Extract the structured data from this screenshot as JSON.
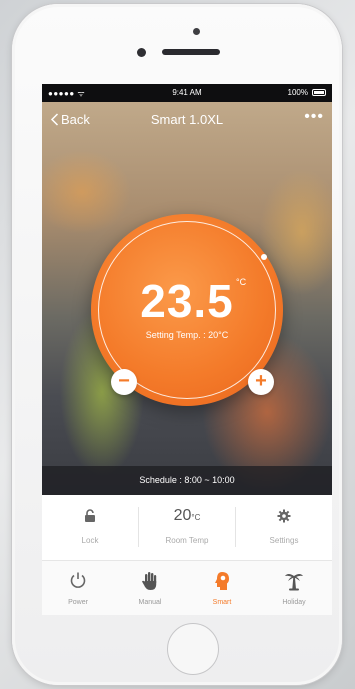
{
  "status_bar": {
    "signal": "●●●●● ᯤ",
    "time": "9:41 AM",
    "battery": "100%"
  },
  "nav": {
    "back_label": "Back",
    "title": "Smart 1.0XL",
    "more": "•••"
  },
  "dial": {
    "temperature": "23.5",
    "unit": "°C",
    "setting_text": "Setting Temp. : 20°C",
    "minus": "−",
    "plus": "+"
  },
  "schedule": {
    "text": "Schedule : 8:00 ~ 10:00"
  },
  "info": {
    "lock_label": "Lock",
    "room_temp_value": "20",
    "room_temp_unit": "°C",
    "room_temp_label": "Room Temp",
    "settings_label": "Settings"
  },
  "tabs": [
    {
      "label": "Power"
    },
    {
      "label": "Manual"
    },
    {
      "label": "Smart"
    },
    {
      "label": "Holiday"
    }
  ],
  "colors": {
    "accent": "#f47b2a",
    "tab_inactive": "#9a9a9a"
  },
  "icons": [
    "lock-icon",
    "gear-icon",
    "power-icon",
    "hand-icon",
    "smart-head-icon",
    "palm-tree-icon",
    "chevron-left-icon",
    "more-icon"
  ]
}
